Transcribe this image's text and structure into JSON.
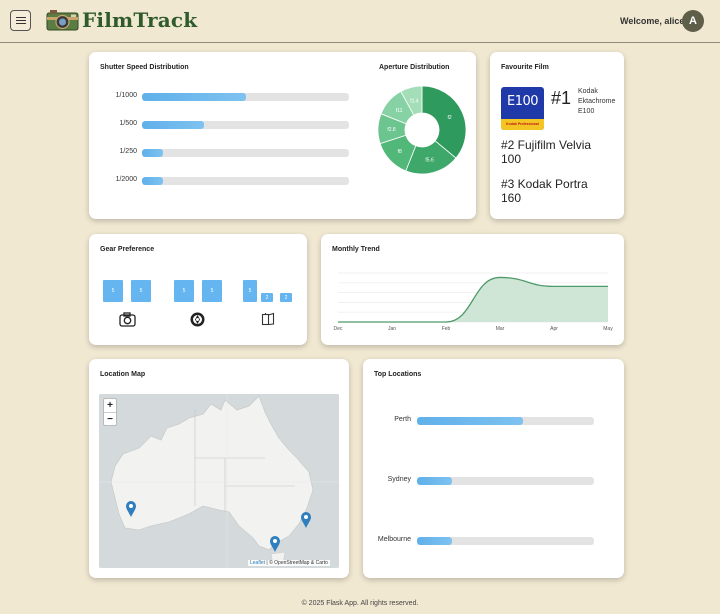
{
  "header": {
    "brand": "FilmTrack",
    "welcome": "Welcome, alice",
    "avatar_initial": "A"
  },
  "shutter": {
    "title": "Shutter Speed Distribution",
    "items": [
      {
        "label": "1/1000",
        "fraction": 0.5
      },
      {
        "label": "1/500",
        "fraction": 0.3
      },
      {
        "label": "1/250",
        "fraction": 0.1
      },
      {
        "label": "1/2000",
        "fraction": 0.1
      }
    ]
  },
  "aperture": {
    "title": "Aperture Distribution",
    "slices": [
      {
        "label": "f2",
        "value": 36,
        "color": "#2f9a5e"
      },
      {
        "label": "f5.6",
        "value": 20,
        "color": "#3da86a"
      },
      {
        "label": "f8",
        "value": 14,
        "color": "#52b87a"
      },
      {
        "label": "f2.8",
        "value": 11,
        "color": "#6cc48f"
      },
      {
        "label": "f11",
        "value": 11,
        "color": "#86d2a4"
      },
      {
        "label": "f1.4",
        "value": 8,
        "color": "#a3deb8"
      }
    ]
  },
  "favourite": {
    "title": "Favourite Film",
    "top_rank": "#1",
    "top_name_lines": [
      "Kodak",
      "Ektachrome",
      "E100"
    ],
    "box_text": "E100",
    "box_brand": "Kodak Professional",
    "second": [
      "#2 Fujifilm Velvia",
      "100"
    ],
    "third": [
      "#3 Kodak Portra",
      "160"
    ],
    "colors": {
      "box": "#1f3aa8",
      "strip": "#f3c623"
    }
  },
  "gear": {
    "title": "Gear Preference",
    "groups": [
      {
        "icon": "camera-icon",
        "bars": [
          5,
          5
        ]
      },
      {
        "icon": "lens-aperture-icon",
        "bars": [
          5,
          5
        ]
      },
      {
        "icon": "film-roll-icon",
        "bars": [
          5,
          2,
          2
        ]
      }
    ]
  },
  "trend": {
    "title": "Monthly Trend",
    "chart_data": {
      "type": "area",
      "categories": [
        "Dec",
        "Jan",
        "Feb",
        "Mar",
        "Apr",
        "May"
      ],
      "values": [
        0,
        0,
        0,
        1,
        0.8,
        0.8
      ],
      "ylim": [
        0,
        1.1
      ],
      "grid": true,
      "color": "#4e9a6a"
    }
  },
  "map": {
    "title": "Location Map",
    "zoom_in": "+",
    "zoom_out": "−",
    "attribution_leaflet": "Leaflet",
    "attribution_rest": "| © OpenStreetMap & Carto",
    "marker_color": "#2f7fbf"
  },
  "top_locations": {
    "title": "Top Locations",
    "items": [
      {
        "label": "Perth",
        "fraction": 0.6
      },
      {
        "label": "Sydney",
        "fraction": 0.2
      },
      {
        "label": "Melbourne",
        "fraction": 0.2
      }
    ]
  },
  "footer": "© 2025 Flask App. All rights reserved."
}
